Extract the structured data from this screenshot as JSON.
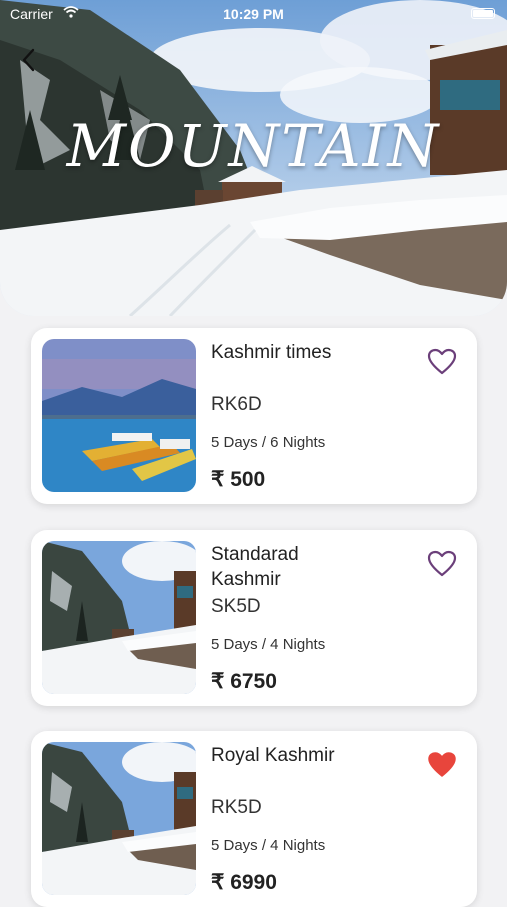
{
  "status_bar": {
    "carrier": "Carrier",
    "time": "10:29 PM"
  },
  "hero": {
    "title": "MOUNTAIN"
  },
  "packages": [
    {
      "name": "Kashmir times",
      "code": "RK6D",
      "duration": "5 Days / 6 Nights",
      "price": "₹ 500",
      "favorited": false,
      "image": "lake-boats"
    },
    {
      "name": "Standarad Kashmir",
      "code": "SK5D",
      "duration": "5 Days / 4 Nights",
      "price": "₹ 6750",
      "favorited": false,
      "image": "snow-village"
    },
    {
      "name": "Royal Kashmir",
      "code": "RK5D",
      "duration": "5 Days / 4 Nights",
      "price": "₹ 6990",
      "favorited": true,
      "image": "snow-village"
    }
  ],
  "colors": {
    "heart_outline": "#6b3f7a",
    "heart_filled": "#e8453c"
  }
}
